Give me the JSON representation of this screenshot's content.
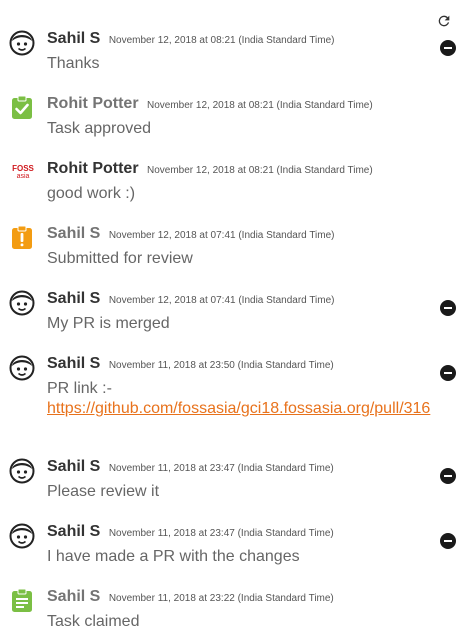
{
  "toolbar": {
    "refresh_icon": "refresh-icon"
  },
  "colors": {
    "link": "#e8721c",
    "approved": "#7bbf44",
    "submitted": "#f39c12",
    "claimed": "#7bbf44"
  },
  "comments": [
    {
      "author": "Sahil S",
      "time": "November 12, 2018 at 08:21 (India Standard Time)",
      "text": "Thanks",
      "avatar_icon": "avatar-face-icon"
    },
    {
      "author": "Rohit Potter",
      "time": "November 12, 2018 at 08:21 (India Standard Time)",
      "text": "Task approved",
      "avatar_icon": "clipboard-check-icon"
    },
    {
      "author": "Rohit Potter",
      "time": "November 12, 2018 at 08:21 (India Standard Time)",
      "text": "good work :)",
      "avatar_icon": "foss-asia-logo",
      "avatar_text": "FOSS asia"
    },
    {
      "author": "Sahil S",
      "time": "November 12, 2018 at 07:41 (India Standard Time)",
      "text": "Submitted for review",
      "avatar_icon": "clipboard-alert-icon"
    },
    {
      "author": "Sahil S",
      "time": "November 12, 2018 at 07:41 (India Standard Time)",
      "text": "My PR is merged",
      "avatar_icon": "avatar-face-icon"
    },
    {
      "author": "Sahil S",
      "time": "November 11, 2018 at 23:50 (India Standard Time)",
      "text": "PR link :-",
      "link": "https://github.com/fossasia/gci18.fossasia.org/pull/316",
      "avatar_icon": "avatar-face-icon"
    },
    {
      "author": "Sahil S",
      "time": "November 11, 2018 at 23:47 (India Standard Time)",
      "text": "Please review it",
      "avatar_icon": "avatar-face-icon"
    },
    {
      "author": "Sahil S",
      "time": "November 11, 2018 at 23:47 (India Standard Time)",
      "text": "I have made a PR with the changes",
      "avatar_icon": "avatar-face-icon"
    },
    {
      "author": "Sahil S",
      "time": "November 11, 2018 at 23:22 (India Standard Time)",
      "text": "Task claimed",
      "avatar_icon": "clipboard-list-icon"
    }
  ]
}
